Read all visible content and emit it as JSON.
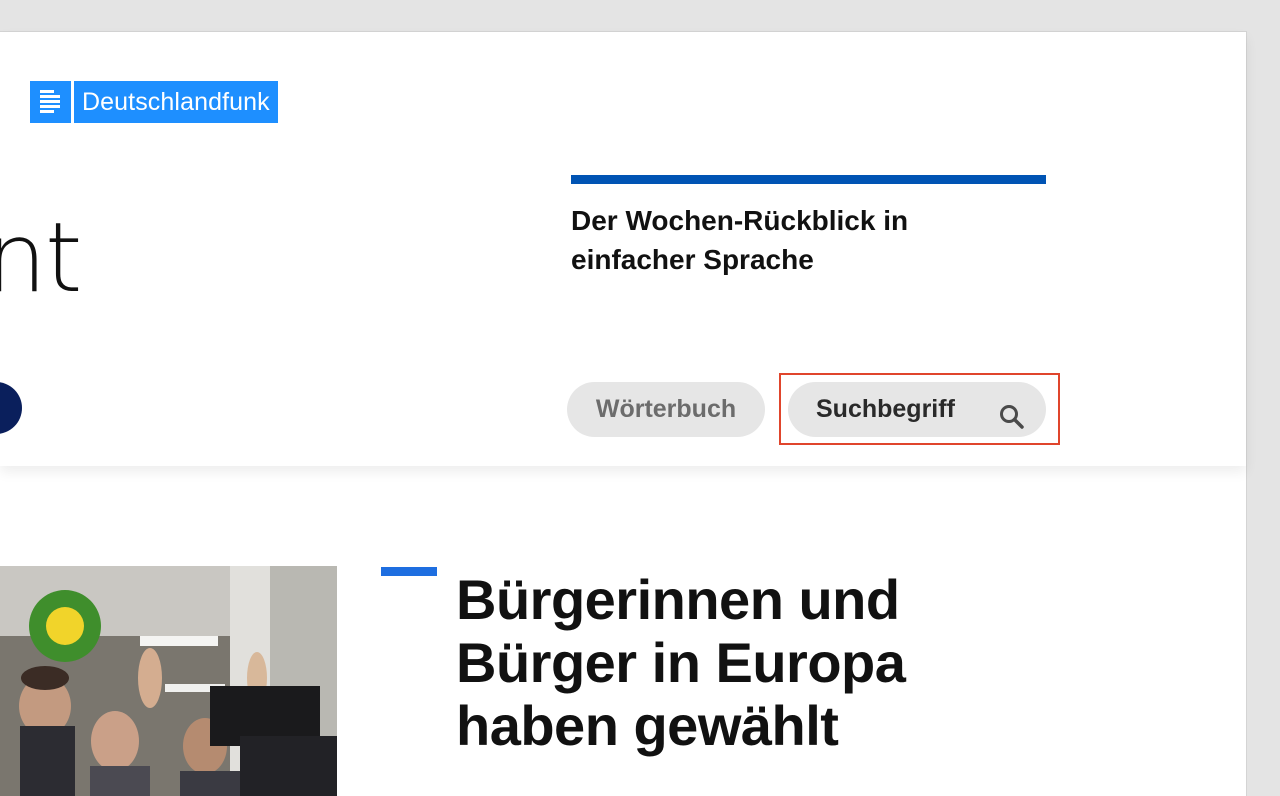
{
  "brand": {
    "name": "Deutschlandfunk",
    "icon": "dlf-logo-icon",
    "color": "#1e8fff"
  },
  "hero": {
    "partial_title": "nt"
  },
  "teaser": {
    "title": "Der Wochen-Rückblick in einfacher Sprache",
    "accent_color": "#0054b4"
  },
  "controls": {
    "dictionary_label": "Wörterbuch",
    "search_label": "Suchbegriff",
    "search_icon": "search-icon"
  },
  "article": {
    "title": "Bürgerinnen und Bürger in Europa haben gewählt",
    "accent_color": "#1e6ee0"
  }
}
